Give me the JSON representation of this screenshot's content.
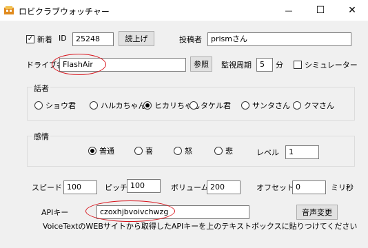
{
  "window": {
    "title": "ロビクラブウォッチャー",
    "minimize_glyph": "—",
    "maximize_glyph": "☐",
    "close_glyph": "✕"
  },
  "row1": {
    "new_checkbox_checked": true,
    "new_label": "新着",
    "id_label": "ID",
    "id_value": "25248",
    "read_button": "読上げ",
    "poster_label": "投稿者",
    "poster_value": "prismさん"
  },
  "row2": {
    "drive_label": "ドライブ名",
    "drive_value": "FlashAir",
    "browse_button": "参照",
    "interval_label": "監視周期",
    "interval_value": "5",
    "interval_unit": "分",
    "simulator_label": "シミュレーター",
    "simulator_checked": false
  },
  "speaker": {
    "group_label": "話者",
    "options": [
      "ショウ君",
      "ハルカちゃん",
      "ヒカリちゃん",
      "タケル君",
      "サンタさん",
      "クマさん"
    ],
    "selected": "ヒカリちゃん"
  },
  "emotion": {
    "group_label": "感情",
    "options": [
      "普通",
      "喜",
      "怒",
      "悲"
    ],
    "selected": "普通",
    "level_label": "レベル",
    "level_value": "1"
  },
  "voice": {
    "speed_label": "スピード",
    "speed_value": "100",
    "pitch_label": "ピッチ",
    "pitch_value": "100",
    "volume_label": "ボリューム",
    "volume_value": "200",
    "offset_label": "オフセット",
    "offset_value": "0",
    "offset_unit": "ミリ秒"
  },
  "api": {
    "label": "APIキー",
    "value": "czoxhjbvoivchwzg",
    "change_button": "音声変更",
    "hint": "VoiceTextのWEBサイトから取得したAPIキーを上のテキストボックスに貼りつけてください"
  },
  "annotation_color": "#d8141c"
}
